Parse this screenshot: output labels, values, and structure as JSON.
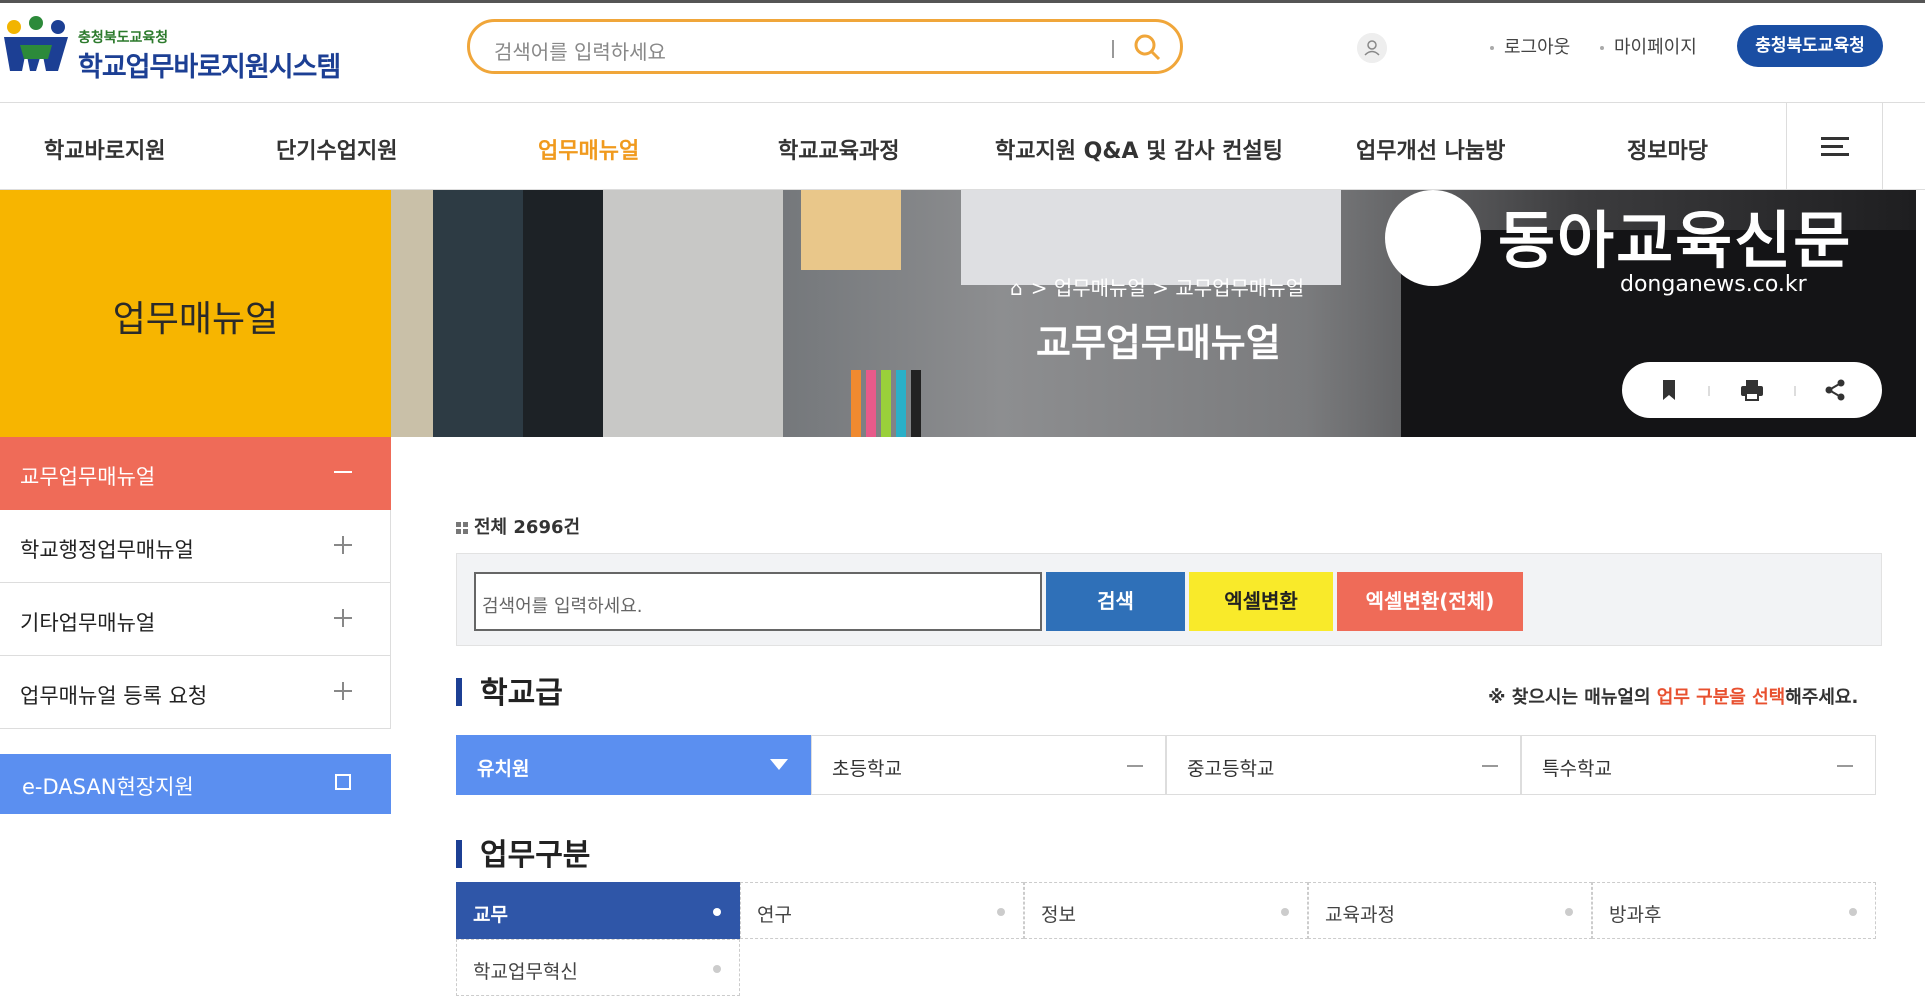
{
  "header": {
    "org_small": "충청북도교육청",
    "system_name": "학교업무바로지원시스템",
    "search_placeholder": "검색어를 입력하세요",
    "logout": "로그아웃",
    "mypage": "마이페이지",
    "org_button": "충청북도교육청"
  },
  "gnb": {
    "items": [
      "학교바로지원",
      "단기수업지원",
      "업무매뉴얼",
      "학교교육과정",
      "학교지원 Q&A 및 감사 컨설팅",
      "업무개선 나눔방",
      "정보마당"
    ],
    "active_index": 2
  },
  "side_title": "업무매뉴얼",
  "banner": {
    "breadcrumb_1": "업무매뉴얼",
    "breadcrumb_2": "교무업무매뉴얼",
    "page_title": "교무업무매뉴얼",
    "watermark_name": "동아교육신문",
    "watermark_url": "donganews.co.kr"
  },
  "lnb": {
    "items": [
      "교무업무매뉴얼",
      "학교행정업무매뉴얼",
      "기타업무매뉴얼",
      "업무매뉴얼 등록 요청"
    ],
    "active_index": 0,
    "external": "e-DASAN현장지원"
  },
  "content": {
    "total_label": "전체",
    "total_count": "2696건",
    "search_placeholder": "검색어를 입력하세요.",
    "search_button": "검색",
    "excel_button": "엑셀변환",
    "excel_all_button": "엑셀변환(전체)",
    "school_level_title": "학교급",
    "notice_prefix": "※ 찾으시는 매뉴얼의 ",
    "notice_highlight": "업무 구분을 선택",
    "notice_suffix": "해주세요.",
    "school_levels": [
      "유치원",
      "초등학교",
      "중고등학교",
      "특수학교"
    ],
    "task_title": "업무구분",
    "tasks": [
      "교무",
      "연구",
      "정보",
      "교육과정",
      "방과후",
      "학교업무혁신"
    ]
  },
  "colors": {
    "accent_orange": "#f09a1e",
    "side_yellow": "#f7b500",
    "active_red": "#ef6b58",
    "primary_blue": "#2f70b8",
    "level_blue": "#5b8ff0",
    "task_blue": "#2f56a8",
    "org_blue": "#1a4ea3"
  },
  "icons": {
    "search": "search-icon",
    "user": "user-icon",
    "menu": "hamburger-icon",
    "home": "home-icon",
    "bookmark": "bookmark-icon",
    "print": "print-icon",
    "share": "share-icon",
    "external": "external-link-icon"
  }
}
